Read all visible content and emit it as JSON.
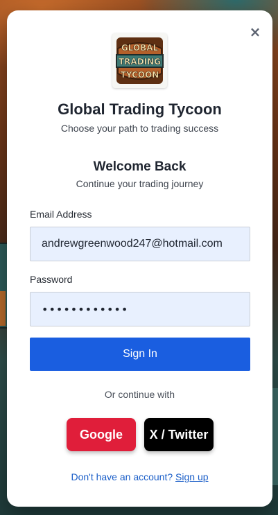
{
  "modal": {
    "close_symbol": "×",
    "logo": {
      "icon": "global-trading-tycoon-logo",
      "line1": "GLOBAL",
      "line2": "TRADING",
      "line3": "TYCOON"
    },
    "app_title": "Global Trading Tycoon",
    "app_subtitle": "Choose your path to trading success",
    "welcome_title": "Welcome Back",
    "welcome_subtitle": "Continue your trading journey"
  },
  "form": {
    "email": {
      "label": "Email Address",
      "value": "andrewgreenwood247@hotmail.com"
    },
    "password": {
      "label": "Password",
      "value": "••••••••••••"
    },
    "submit_label": "Sign In"
  },
  "social": {
    "divider_text": "Or continue with",
    "google_label": "Google",
    "twitter_label": "X / Twitter"
  },
  "footer": {
    "prompt": "Don't have an account?",
    "signup_label": "Sign up"
  },
  "colors": {
    "primary": "#1a5ee0",
    "google": "#e01e3a",
    "twitter": "#000000",
    "input_bg": "#e8f0fe"
  }
}
